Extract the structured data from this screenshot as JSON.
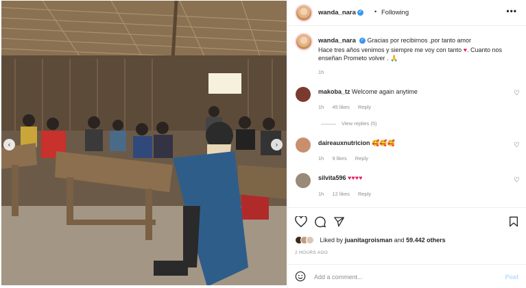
{
  "post": {
    "photo_description_icon": "classroom-photo",
    "nav_prev": "‹",
    "nav_next": "›"
  },
  "header": {
    "username": "wanda_nara",
    "verified_mark": "✓",
    "separator": "•",
    "follow_status": "Following",
    "more_label": "•••"
  },
  "caption": {
    "username": "wanda_nara",
    "text_line1": "Gracias por recibirnos ,por tanto amor",
    "text_line2_a": "Hace tres años venimos y siempre me voy con tanto",
    "heart": "♥",
    "text_line2_b": ". Cuanto nos enseñan Prometo volver .",
    "pray": "🙏",
    "time": "1h"
  },
  "comments": [
    {
      "username": "makoba_tz",
      "text": "Welcome again anytime",
      "time": "1h",
      "likes": "45 likes",
      "reply": "Reply",
      "avatar_color": "#7a3b2e"
    },
    {
      "username": "daireauxnutricion",
      "text": "🥰🥰🥰",
      "time": "1h",
      "likes": "9 likes",
      "reply": "Reply",
      "avatar_color": "#c98f6d"
    },
    {
      "username": "silvita596",
      "text": "♥♥♥♥",
      "time": "1h",
      "likes": "12 likes",
      "reply": "Reply",
      "avatar_color": "#9a8a7a"
    }
  ],
  "view_replies": "View replies (5)",
  "likes_summary": {
    "prefix": "Liked by",
    "user": "juanitagroisman",
    "middle": "and",
    "count": "59.442 others"
  },
  "post_time": "2 HOURS AGO",
  "add_comment": {
    "placeholder": "Add a comment...",
    "post_label": "Post"
  },
  "colors": {
    "verified": "#3897f0",
    "heart": "#e0245e",
    "post_button": "#b3dbff"
  }
}
